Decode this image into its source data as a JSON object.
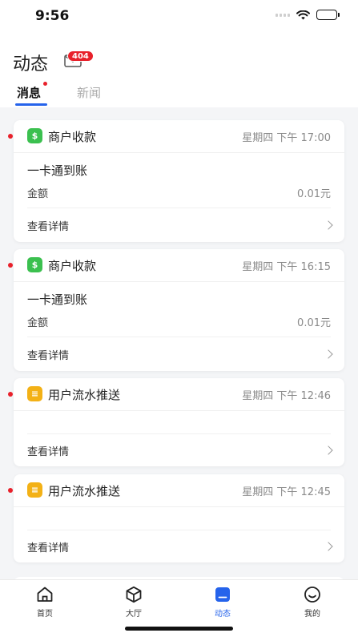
{
  "status_bar": {
    "time": "9:56"
  },
  "header": {
    "title": "动态",
    "mail_badge": "404"
  },
  "tabs": [
    {
      "label": "消息",
      "active": true,
      "unread": true
    },
    {
      "label": "新闻",
      "active": false
    }
  ],
  "cards": [
    {
      "app_icon": "wallet-icon",
      "title": "商户收款",
      "time": "星期四 下午 17:00",
      "subtitle": "一卡通到账",
      "amount_label": "金额",
      "amount_value": "0.01元",
      "detail_label": "查看详情"
    },
    {
      "app_icon": "wallet-icon",
      "title": "商户收款",
      "time": "星期四 下午 16:15",
      "subtitle": "一卡通到账",
      "amount_label": "金额",
      "amount_value": "0.01元",
      "detail_label": "查看详情"
    },
    {
      "app_icon": "stream-icon",
      "title": "用户流水推送",
      "time": "星期四 下午 12:46",
      "detail_label": "查看详情"
    },
    {
      "app_icon": "stream-icon",
      "title": "用户流水推送",
      "time": "星期四 下午 12:45",
      "detail_label": "查看详情"
    }
  ],
  "bottom_nav": [
    {
      "label": "首页",
      "icon": "home-icon",
      "active": false
    },
    {
      "label": "大厅",
      "icon": "cube-icon",
      "active": false
    },
    {
      "label": "动态",
      "icon": "feed-icon",
      "active": true
    },
    {
      "label": "我的",
      "icon": "smile-icon",
      "active": false
    }
  ],
  "colors": {
    "accent": "#2563eb",
    "unread": "#e8212b",
    "payment_icon": "#3bc04f",
    "stream_icon": "#f3b116"
  }
}
